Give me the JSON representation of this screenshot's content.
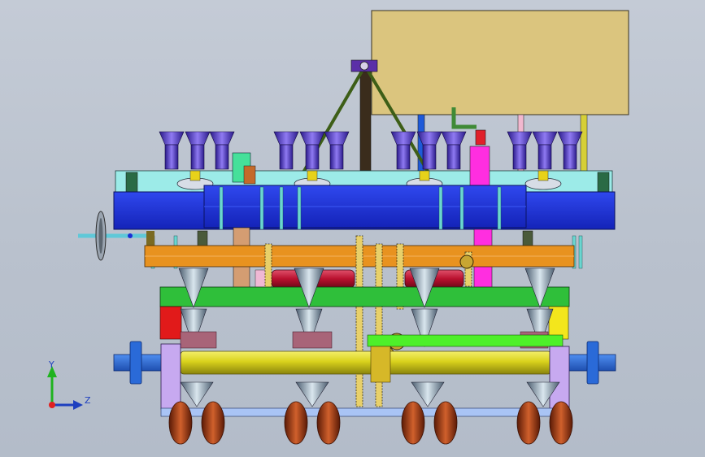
{
  "axes": {
    "y_label": "Y",
    "z_label": "Z",
    "y_color": "#1fb31f",
    "z_color": "#1d3fbf",
    "origin_color": "#e02020"
  },
  "colors": {
    "background_top": "#c4cbd6",
    "background_bottom": "#b3bcc9",
    "seed_box": "#dbc57e",
    "blue_beam": "#1a2fd6",
    "cyan_beam": "#9cebe8",
    "orange_bar": "#e8921f",
    "green_frame": "#2fbf3a",
    "yellow_shaft": "#d9d21c",
    "crimson_roller": "#b8102e",
    "magenta_post": "#ff2ee0",
    "purple_hopper": "#5a3fd6",
    "copper_disc": "#a8401a",
    "lavender_plate": "#c7a9f0",
    "olive_link": "#3d5e17"
  },
  "icons": [
    "coordinate-triad-icon"
  ]
}
